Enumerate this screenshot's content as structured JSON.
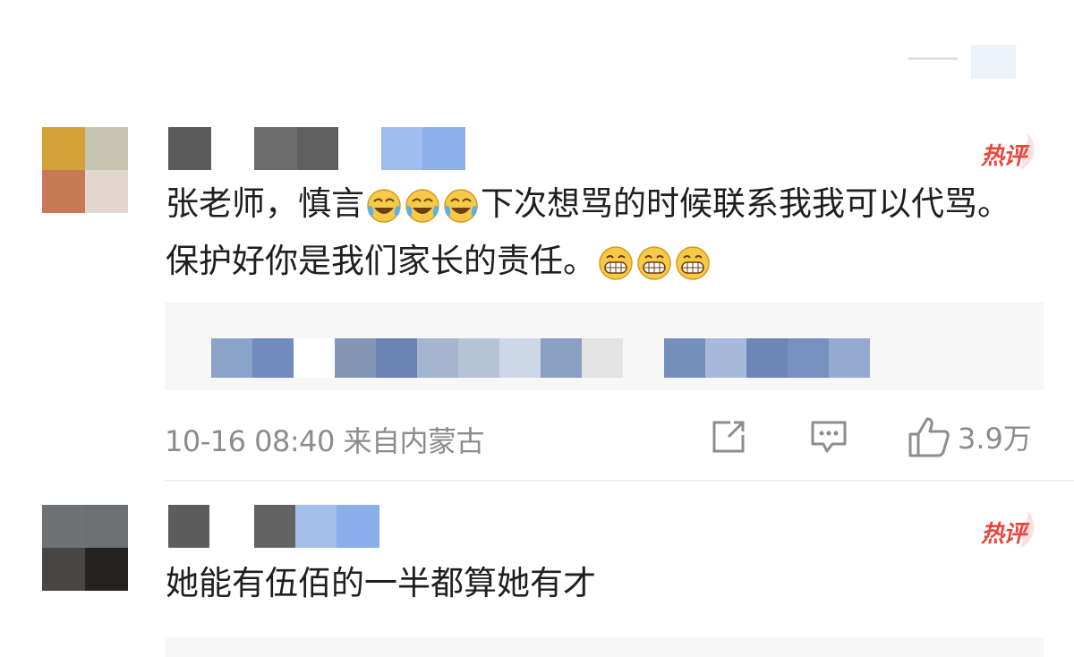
{
  "comments": [
    {
      "badge": "热评",
      "text_before": "张老师，慎言",
      "emoji_1": "crying-laughing",
      "text_after": "下次想骂的时候联系我我可以代骂。保护好你是我们家长的责任。",
      "emoji_2": "grinning",
      "time": "10-16 08:40 来自内蒙古",
      "actions": {
        "share_icon": "share-icon",
        "comment_icon": "comment-icon",
        "like_icon": "thumbs-up-icon",
        "like_count": "3.9万"
      }
    },
    {
      "badge": "热评",
      "text": "她能有伍佰的一半都算她有才"
    }
  ],
  "colors": {
    "hot_badge": "#e8473e",
    "meta_text": "#8c8c8c",
    "quote_bg": "#f7f7f7"
  }
}
